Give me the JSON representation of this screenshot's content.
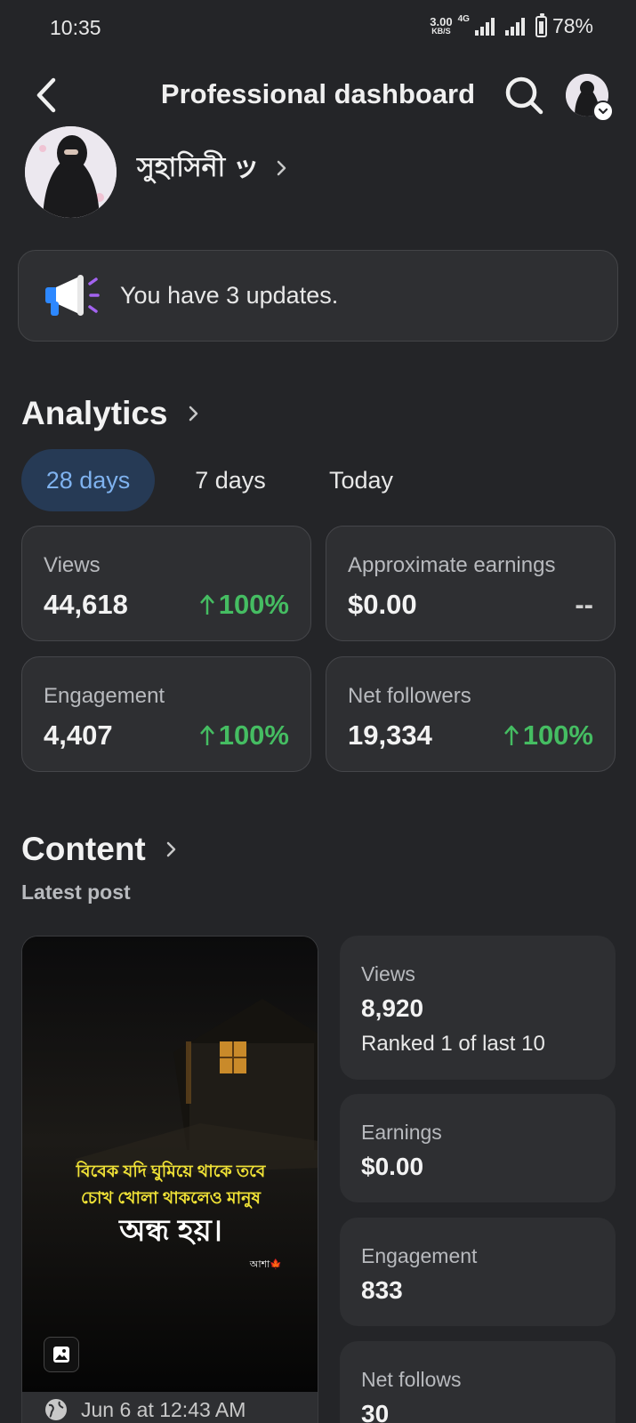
{
  "status_bar": {
    "time": "10:35",
    "net_speed_value": "3.00",
    "net_speed_unit": "KB/S",
    "network_type": "4G",
    "battery": "78%"
  },
  "header": {
    "title": "Professional dashboard"
  },
  "profile": {
    "name": "সুহাসিনী ッ"
  },
  "updates": {
    "text": "You have 3 updates."
  },
  "analytics": {
    "title": "Analytics",
    "tabs": [
      "28 days",
      "7 days",
      "Today"
    ],
    "selected_tab": "28 days",
    "metrics": [
      {
        "label": "Views",
        "value": "44,618",
        "change": "100%",
        "trend": "up"
      },
      {
        "label": "Approximate earnings",
        "value": "$0.00",
        "change": "--",
        "trend": "none"
      },
      {
        "label": "Engagement",
        "value": "4,407",
        "change": "100%",
        "trend": "up"
      },
      {
        "label": "Net followers",
        "value": "19,334",
        "change": "100%",
        "trend": "up"
      }
    ]
  },
  "content": {
    "title": "Content",
    "subtitle": "Latest post",
    "post": {
      "caption_line1": "বিবেক যদি ঘুমিয়ে থাকে তবে",
      "caption_line2": "চোখ খোলা থাকলেও মানুষ",
      "caption_line3": "অন্ধ হয়।",
      "signature": "আশা🍁",
      "date": "Jun 6 at 12:43 AM"
    },
    "stats": [
      {
        "label": "Views",
        "value": "8,920",
        "sub": "Ranked 1 of last 10"
      },
      {
        "label": "Earnings",
        "value": "$0.00"
      },
      {
        "label": "Engagement",
        "value": "833"
      },
      {
        "label": "Net follows",
        "value": "30"
      }
    ]
  },
  "colors": {
    "background": "#242528",
    "card": "#2e2f32",
    "accent_blue": "#7fb2ef",
    "positive_green": "#45bd62"
  }
}
